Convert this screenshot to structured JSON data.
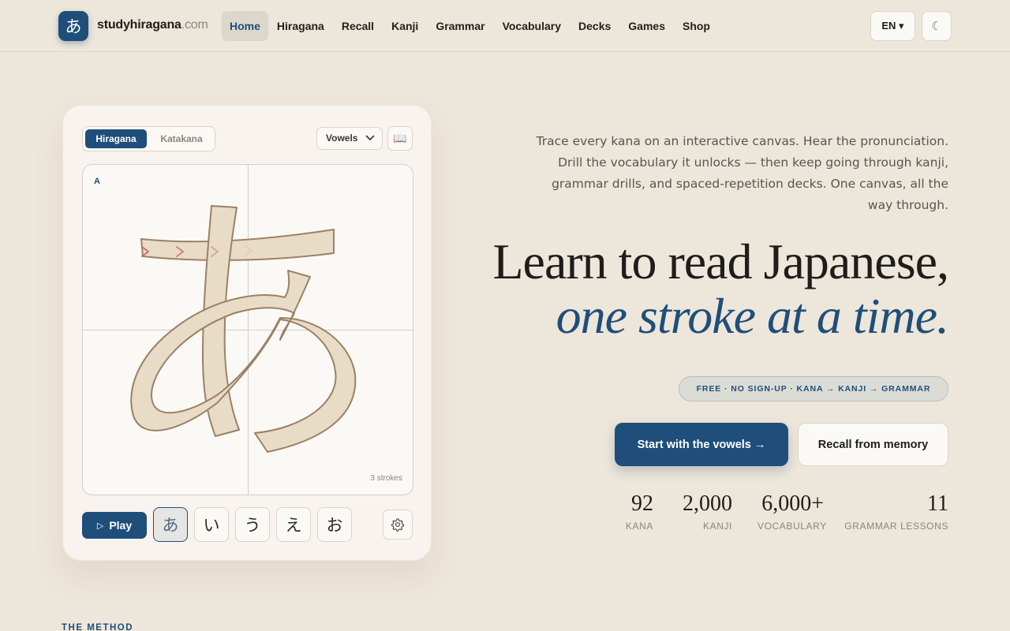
{
  "brand": {
    "logo_glyph": "あ",
    "name": "studyhiragana",
    "tld": ".com"
  },
  "nav": {
    "items": [
      {
        "label": "Home",
        "active": true
      },
      {
        "label": "Hiragana"
      },
      {
        "label": "Recall"
      },
      {
        "label": "Kanji"
      },
      {
        "label": "Grammar"
      },
      {
        "label": "Vocabulary"
      },
      {
        "label": "Decks"
      },
      {
        "label": "Games"
      },
      {
        "label": "Shop"
      }
    ],
    "language": "EN ▾",
    "theme_icon": "☾"
  },
  "practice": {
    "script_toggle": {
      "selected": "Hiragana",
      "other": "Katakana"
    },
    "group_select": "Vowels",
    "book_icon": "📖",
    "current_romaji": "A",
    "current_kana": "あ",
    "stroke_count": "3 strokes",
    "play_label": "Play",
    "play_icon": "▷",
    "kana_options": [
      "あ",
      "い",
      "う",
      "え",
      "お"
    ],
    "selected_index": 0
  },
  "hero": {
    "blurb_lines": [
      "Trace every kana on an interactive canvas. Hear the pronunciation.",
      "Drill the vocabulary it unlocks — then keep going through kanji,",
      "grammar drills, and spaced-repetition decks. One canvas, all the",
      "way through."
    ],
    "headline": "Learn to read Japanese,",
    "headline_italic": "one stroke at a time.",
    "pill": "FREE · NO SIGN-UP · KANA → KANJI → GRAMMAR",
    "cta_primary": "Start with the vowels →",
    "cta_secondary": "Recall from memory",
    "stats": [
      {
        "value": "92",
        "label": "KANA"
      },
      {
        "value": "2,000",
        "label": "KANJI"
      },
      {
        "value": "6,000+",
        "label": "VOCABULARY"
      },
      {
        "value": "11",
        "label": "GRAMMAR LESSONS"
      }
    ]
  },
  "section": {
    "label": "THE METHOD"
  },
  "colors": {
    "background": "#ede6da",
    "accent": "#1f4e7a",
    "card": "#f8f3ee",
    "stroke_fill": "#e9dcc6",
    "stroke_outline": "#9a8166",
    "direction_arrows": "#c96e6e"
  }
}
